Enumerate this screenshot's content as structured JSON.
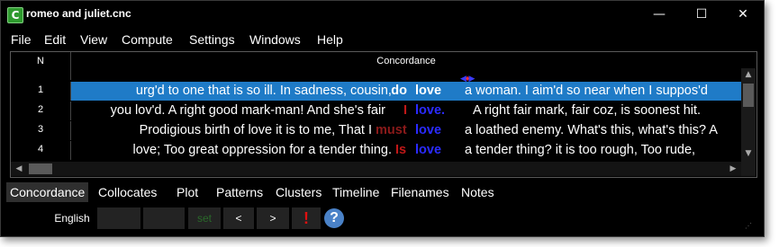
{
  "window": {
    "title": "romeo and juliet.cnc",
    "app_icon": "C",
    "min_glyph": "—",
    "max_glyph": "☐",
    "close_glyph": "✕"
  },
  "menu": [
    "File",
    "Edit",
    "View",
    "Compute",
    "Settings",
    "Windows",
    "Help"
  ],
  "table": {
    "col_n": "N",
    "col_concordance": "Concordance",
    "rows": [
      {
        "n": "1",
        "left": "urg'd to one that is so ill. In sadness, cousin, I",
        "coll": "do",
        "kw": "love",
        "right": "a woman. I aim'd so near when I suppos'd"
      },
      {
        "n": "2",
        "left": "you lov'd. A right good mark-man! And she's fair",
        "coll": "I",
        "kw": "love.",
        "right": "A right fair mark, fair coz, is soonest hit."
      },
      {
        "n": "3",
        "left": "Prodigious birth of love it is to me, That I",
        "coll": "must",
        "kw": "love",
        "right": "a loathed enemy. What's this, what's this? A"
      },
      {
        "n": "4",
        "left": "love; Too great oppression for a tender thing.",
        "coll": "Is",
        "kw": "love",
        "right": "a tender thing? it is too rough, Too rude,"
      }
    ]
  },
  "tabs": [
    "Concordance",
    "Collocates",
    "Plot",
    "Patterns",
    "Clusters",
    "Timeline",
    "Filenames",
    "Notes"
  ],
  "status": {
    "language": "English",
    "set_label": "set",
    "prev_label": "<",
    "next_label": ">",
    "alert_label": "!",
    "help_label": "?"
  },
  "colors": {
    "selection": "#1f7bc7",
    "keyword": "#2b2bff",
    "collocate": "#8b1a1a"
  }
}
